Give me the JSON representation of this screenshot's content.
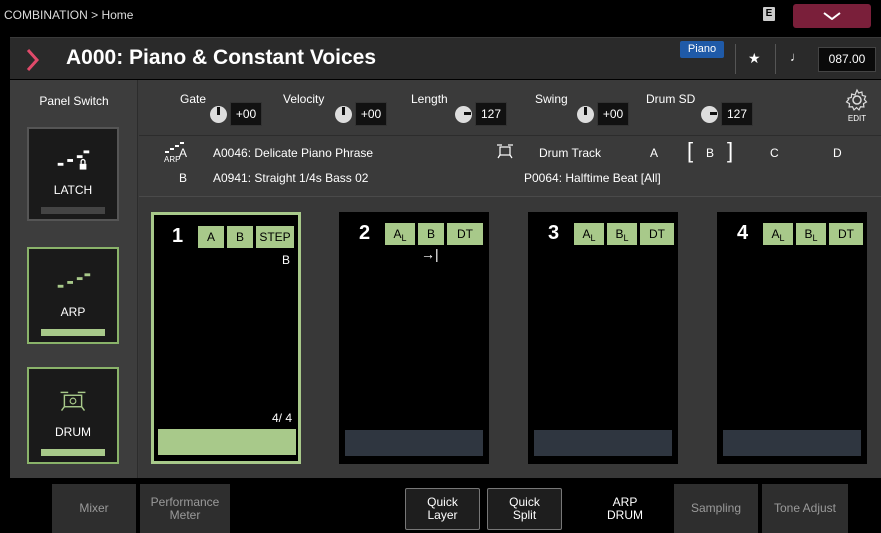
{
  "breadcrumb": "COMBINATION > Home",
  "status": {
    "e_label": "E"
  },
  "title": {
    "program": "A000: Piano & Constant Voices",
    "category": "Piano",
    "tempo": "087.00"
  },
  "panel_switch": {
    "label": "Panel Switch",
    "latch": "LATCH",
    "arp": "ARP",
    "drum": "DRUM"
  },
  "params": {
    "gate_label": "Gate",
    "gate_value": "+00",
    "velocity_label": "Velocity",
    "velocity_value": "+00",
    "length_label": "Length",
    "length_value": "127",
    "swing_label": "Swing",
    "swing_value": "+00",
    "drumsd_label": "Drum SD",
    "drumsd_value": "127",
    "edit_label": "EDIT"
  },
  "arp_info": {
    "arp_icon_label": "ARP",
    "row_a_letter": "A",
    "row_a_pattern": "A0046: Delicate Piano Phrase",
    "row_b_letter": "B",
    "row_b_pattern": "A0941: Straight 1/4s Bass 02",
    "drum_track_label": "Drum Track",
    "drum_pattern": "P0064: Halftime Beat [All]",
    "slots": [
      "A",
      "B",
      "C",
      "D"
    ]
  },
  "tracks": [
    {
      "num": "1",
      "tags": [
        "A",
        "B",
        "STEP"
      ],
      "sub_label": "B",
      "step": "4/ 4"
    },
    {
      "num": "2",
      "tags": [
        "A",
        "B",
        "DT"
      ],
      "subs": [
        "L",
        "",
        ""
      ],
      "arrow": "→|"
    },
    {
      "num": "3",
      "tags": [
        "A",
        "B",
        "DT"
      ],
      "subs": [
        "L",
        "L",
        ""
      ]
    },
    {
      "num": "4",
      "tags": [
        "A",
        "B",
        "DT"
      ],
      "subs": [
        "L",
        "L",
        ""
      ]
    }
  ],
  "bottom_tabs": {
    "mixer": "Mixer",
    "perf1": "Performance",
    "perf2": "Meter",
    "quick_layer1": "Quick",
    "quick_layer2": "Layer",
    "quick_split1": "Quick",
    "quick_split2": "Split",
    "arp_drum1": "ARP",
    "arp_drum2": "DRUM",
    "sampling": "Sampling",
    "tone_adjust": "Tone Adjust"
  }
}
